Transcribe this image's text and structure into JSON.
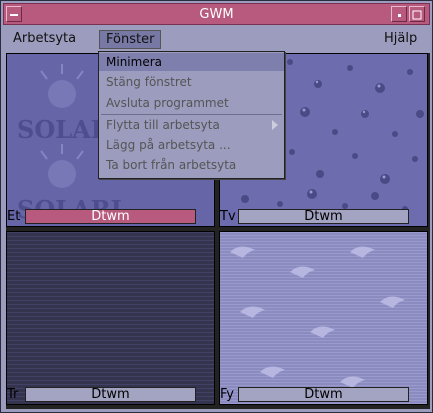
{
  "window": {
    "title": "GWM"
  },
  "menubar": {
    "items": [
      "Arbetsyta",
      "Fönster",
      "Hjälp"
    ]
  },
  "dropdown": {
    "items": [
      {
        "label": "Minimera"
      },
      {
        "label": "Stäng fönstret"
      },
      {
        "label": "Avsluta programmet"
      },
      {
        "label": "Flytta till arbetsyta"
      },
      {
        "label": "Lägg på arbetsyta ..."
      },
      {
        "label": "Ta bort från arbetsyta"
      }
    ]
  },
  "panes": [
    {
      "label": "Et",
      "name": "Dtwm",
      "active": true
    },
    {
      "label": "Tv",
      "name": "Dtwm"
    },
    {
      "label": "Tr",
      "name": "Dtwm"
    },
    {
      "label": "Fy",
      "name": "Dtwm"
    }
  ],
  "colors": {
    "title_bg": "#b85a7e",
    "window_bg": "#9c9cbe",
    "active_label": "#b85a7e"
  }
}
